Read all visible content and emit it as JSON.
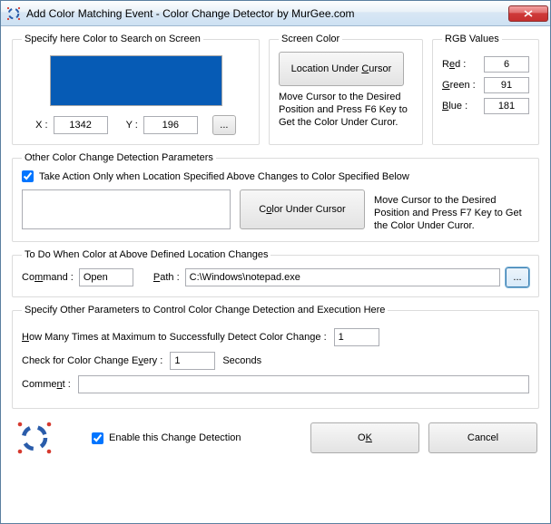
{
  "window": {
    "title": "Add Color Matching Event - Color Change Detector by MurGee.com"
  },
  "search": {
    "legend": "Specify here Color to Search on Screen",
    "swatch_color": "#065bb5",
    "x_label": "X :",
    "x_value": "1342",
    "y_label": "Y :",
    "y_value": "196",
    "browse_label": "..."
  },
  "screen_color": {
    "legend": "Screen Color",
    "button_prefix": "Location Under ",
    "button_accel": "C",
    "button_suffix": "ursor",
    "hint": "Move Cursor to the Desired Position and Press  F6  Key to Get the Color Under Curor."
  },
  "rgb": {
    "legend": "RGB Values",
    "r_prefix": "R",
    "r_accel": "e",
    "r_suffix": "d :",
    "r_value": "6",
    "g_prefix": "",
    "g_accel": "G",
    "g_suffix": "reen :",
    "g_value": "91",
    "b_prefix": "",
    "b_accel": "B",
    "b_suffix": "lue :",
    "b_value": "181"
  },
  "other_params": {
    "legend": "Other Color Change Detection Parameters",
    "checkbox_label": "Take Action Only when Location Specified Above Changes to  Color Specified Below",
    "checkbox_checked": true,
    "button_prefix": "C",
    "button_accel": "o",
    "button_suffix": "lor Under Cursor",
    "hint": "Move Cursor to the Desired Position and Press  F7  Key to Get the Color Under Curor.",
    "swatch_color": "#ffffff"
  },
  "todo": {
    "legend": "To Do When Color at Above Defined Location Changes",
    "command_prefix": "Co",
    "command_accel": "m",
    "command_suffix": "mand :",
    "command_value": "Open",
    "path_prefix": "",
    "path_accel": "P",
    "path_suffix": "ath :",
    "path_value": "C:\\Windows\\notepad.exe",
    "browse_label": "..."
  },
  "extra": {
    "legend": "Specify Other Parameters to Control Color Change Detection and Execution Here",
    "max_prefix": "",
    "max_accel": "H",
    "max_suffix": "ow Many Times at Maximum to Successfully Detect Color Change :",
    "max_value": "1",
    "every_prefix": "Check for Color Change E",
    "every_accel": "v",
    "every_suffix": "ery :",
    "every_value": "1",
    "every_unit": "Seconds",
    "comment_prefix": "Comme",
    "comment_accel": "n",
    "comment_suffix": "t :",
    "comment_value": ""
  },
  "footer": {
    "enable_label": "Enable this Change Detection",
    "enable_checked": true,
    "ok_prefix": "O",
    "ok_accel": "K",
    "ok_suffix": "",
    "cancel_label": "Cancel"
  }
}
